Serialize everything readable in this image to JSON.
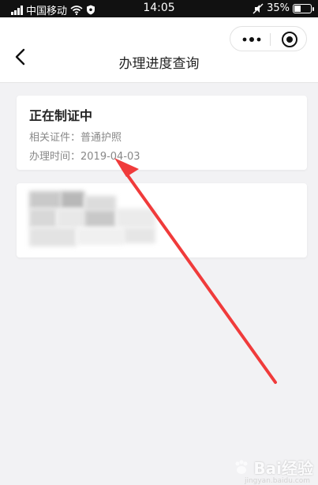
{
  "status_bar": {
    "carrier": "中国移动",
    "time": "14:05",
    "battery": "35%",
    "battery_level": 0.35
  },
  "nav": {
    "title": "办理进度查询"
  },
  "record": {
    "status": "正在制证中",
    "doc_type": "相关证件：普通护照",
    "date": "办理时间：2019-04-03"
  },
  "watermark": {
    "brand": "Bai经验",
    "url": "jingyan.baidu.com"
  },
  "colors": {
    "annotation_arrow": "#f03b3b",
    "background": "#f2f2f4"
  }
}
